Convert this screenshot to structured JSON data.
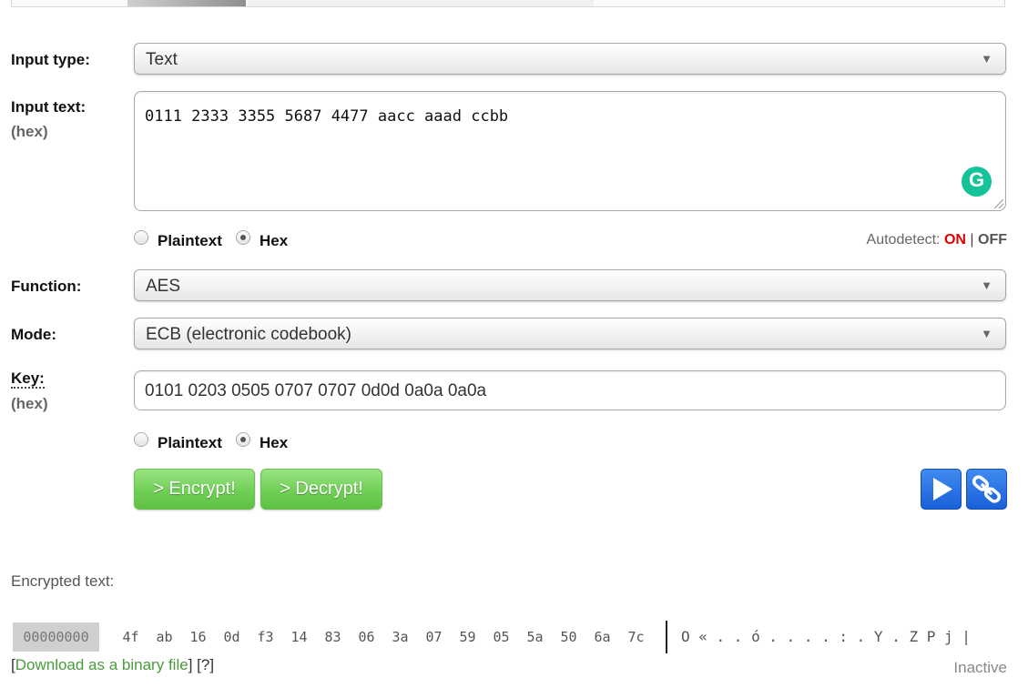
{
  "input_type": {
    "label": "Input type:",
    "value": "Text"
  },
  "input_text": {
    "label": "Input text:",
    "sublabel": "(hex)",
    "value": "0111 2333 3355 5687 4477 aacc aaad ccbb",
    "radio_plaintext": "Plaintext",
    "radio_hex": "Hex",
    "autodetect_label": "Autodetect:",
    "autodetect_on": "ON",
    "autodetect_sep": "|",
    "autodetect_off": "OFF"
  },
  "function": {
    "label": "Function:",
    "value": "AES"
  },
  "mode": {
    "label": "Mode:",
    "value": "ECB (electronic codebook)"
  },
  "key": {
    "label": "Key:",
    "sublabel": "(hex)",
    "value": "0101 0203 0505 0707 0707 0d0d 0a0a 0a0a",
    "radio_plaintext": "Plaintext",
    "radio_hex": "Hex"
  },
  "buttons": {
    "encrypt": "> Encrypt!",
    "decrypt": "> Decrypt!"
  },
  "output": {
    "title": "Encrypted text:",
    "offset": "00000000",
    "bytes": [
      "4f",
      "ab",
      "16",
      "0d",
      "f3",
      "14",
      "83",
      "06",
      "3a",
      "07",
      "59",
      "05",
      "5a",
      "50",
      "6a",
      "7c"
    ],
    "ascii": "O « . . ó . . . . : . Y . Z P j |",
    "download_open": "[",
    "download_link": "Download as a binary file",
    "download_close": "]",
    "help_open": " [",
    "help_link": "?",
    "help_close": "]",
    "status": "Inactive"
  },
  "colors": {
    "accent_on": "#e00000",
    "button_green": "#6fcf56",
    "button_blue": "#1a5fd8",
    "link_green": "#4a9a3c",
    "grammarly": "#15c39a"
  },
  "icons": {
    "play": "play-icon",
    "link": "link-icon",
    "grammarly": "grammarly-icon",
    "dropdown": "chevron-down-icon"
  }
}
